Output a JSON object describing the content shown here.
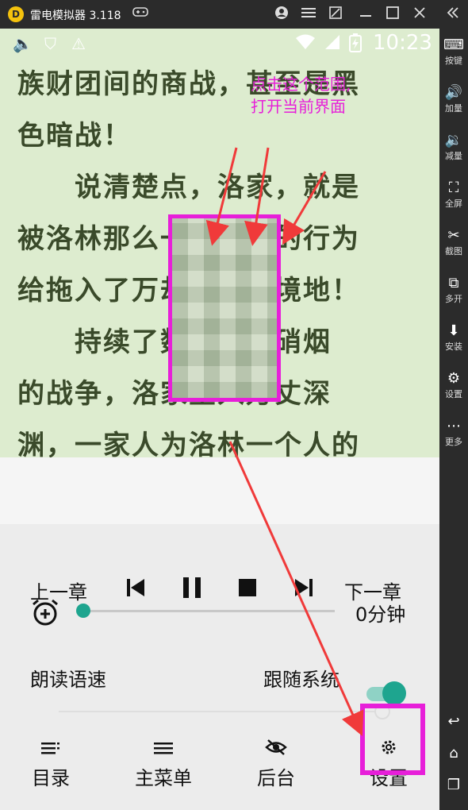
{
  "window": {
    "title": "雷电模拟器 3.118",
    "logo_text": "D"
  },
  "titlebar_icons": [
    "gamepad-icon",
    "user-icon",
    "menu-icon",
    "restore-icon",
    "minimize-icon",
    "maximize-icon",
    "close-icon",
    "collapse-icon"
  ],
  "sidebar": {
    "items": [
      {
        "label": "按键"
      },
      {
        "label": "加量"
      },
      {
        "label": "减量"
      },
      {
        "label": "全屏"
      },
      {
        "label": "截图"
      },
      {
        "label": "多开"
      },
      {
        "label": "安装"
      },
      {
        "label": "设置"
      },
      {
        "label": "更多"
      }
    ]
  },
  "statusbar": {
    "clock": "10:23"
  },
  "reader": {
    "lines": [
      "族财团间的商战，甚至是黑",
      "色暗战！",
      "　　说清楚点，洛家，就是",
      "被洛林那么一个轻狂的行为",
      "给拖入了万劫不复的境地！",
      "　　持续了数年没有硝烟",
      "的战争，洛家坠入万丈深",
      "渊，一家人为洛林一个人的"
    ]
  },
  "annotation": {
    "line1": "点击这个范围,",
    "line2": "打开当前界面"
  },
  "controls": {
    "prev_chapter": "上一章",
    "next_chapter": "下一章",
    "timer_value": "0分钟",
    "timer_progress": 0,
    "speed_label": "朗读语速",
    "follow_system_label": "跟随系统",
    "follow_system_on": true
  },
  "bottom_nav": [
    {
      "label": "目录"
    },
    {
      "label": "主菜单"
    },
    {
      "label": "后台"
    },
    {
      "label": "设置"
    }
  ],
  "colors": {
    "accent": "#1ea58f",
    "annotation": "#e71fd9",
    "arrow": "#f03a3a",
    "reader_bg": "#ddeccf",
    "reader_text": "#3a4a2a"
  }
}
